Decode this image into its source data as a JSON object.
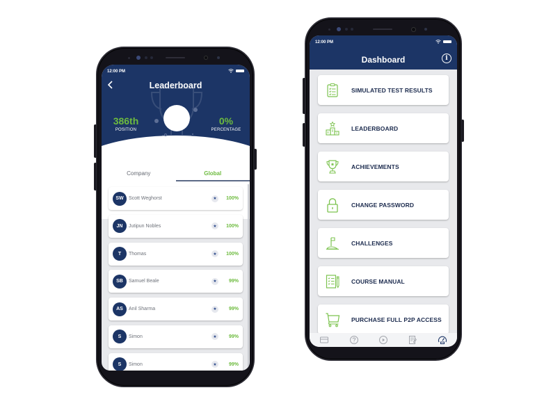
{
  "leaderboard_screen": {
    "status_bar": {
      "time": "12:00 PM"
    },
    "header": {
      "title": "Leaderboard"
    },
    "stats": {
      "position": {
        "value": "386th",
        "label": "POSITION"
      },
      "percentage": {
        "value": "0%",
        "label": "PERCENTAGE"
      }
    },
    "tabs": [
      {
        "label": "Company",
        "active": false
      },
      {
        "label": "Global",
        "active": true
      }
    ],
    "rows": [
      {
        "initials": "SW",
        "name": "Scott Weghorst",
        "score": "100%"
      },
      {
        "initials": "JN",
        "name": "Jutipun Nobles",
        "score": "100%"
      },
      {
        "initials": "T",
        "name": "Thomas",
        "score": "100%"
      },
      {
        "initials": "SB",
        "name": "Samuel Beale",
        "score": "99%"
      },
      {
        "initials": "AS",
        "name": "Anil Sharma",
        "score": "99%"
      },
      {
        "initials": "S",
        "name": "Simon",
        "score": "99%"
      },
      {
        "initials": "S",
        "name": "Simon",
        "score": "99%"
      }
    ],
    "star_glyph": "★"
  },
  "dashboard_screen": {
    "status_bar": {
      "time": "12:00 PM"
    },
    "header": {
      "title": "Dashboard",
      "info_glyph": "i"
    },
    "menu_items": [
      {
        "label": "SIMULATED TEST RESULTS",
        "icon": "clipboard-checklist-icon"
      },
      {
        "label": "LEADERBOARD",
        "icon": "podium-icon"
      },
      {
        "label": "ACHIEVEMENTS",
        "icon": "trophy-icon"
      },
      {
        "label": "CHANGE PASSWORD",
        "icon": "lock-icon"
      },
      {
        "label": "CHALLENGES",
        "icon": "flag-icon"
      },
      {
        "label": "COURSE MANUAL",
        "icon": "manual-icon"
      },
      {
        "label": "PURCHASE FULL P2P ACCESS",
        "icon": "cart-icon"
      }
    ],
    "bottom_nav": [
      {
        "icon": "card-icon",
        "active": false
      },
      {
        "icon": "help-icon",
        "active": false
      },
      {
        "icon": "play-icon",
        "active": false
      },
      {
        "icon": "document-icon",
        "active": false
      },
      {
        "icon": "dashboard-gauge-icon",
        "active": true
      }
    ]
  },
  "colors": {
    "primary_navy": "#1c3566",
    "accent_green": "#6dbb3e",
    "background": "#e8e9ec",
    "label_dark": "#1c2b4e"
  }
}
